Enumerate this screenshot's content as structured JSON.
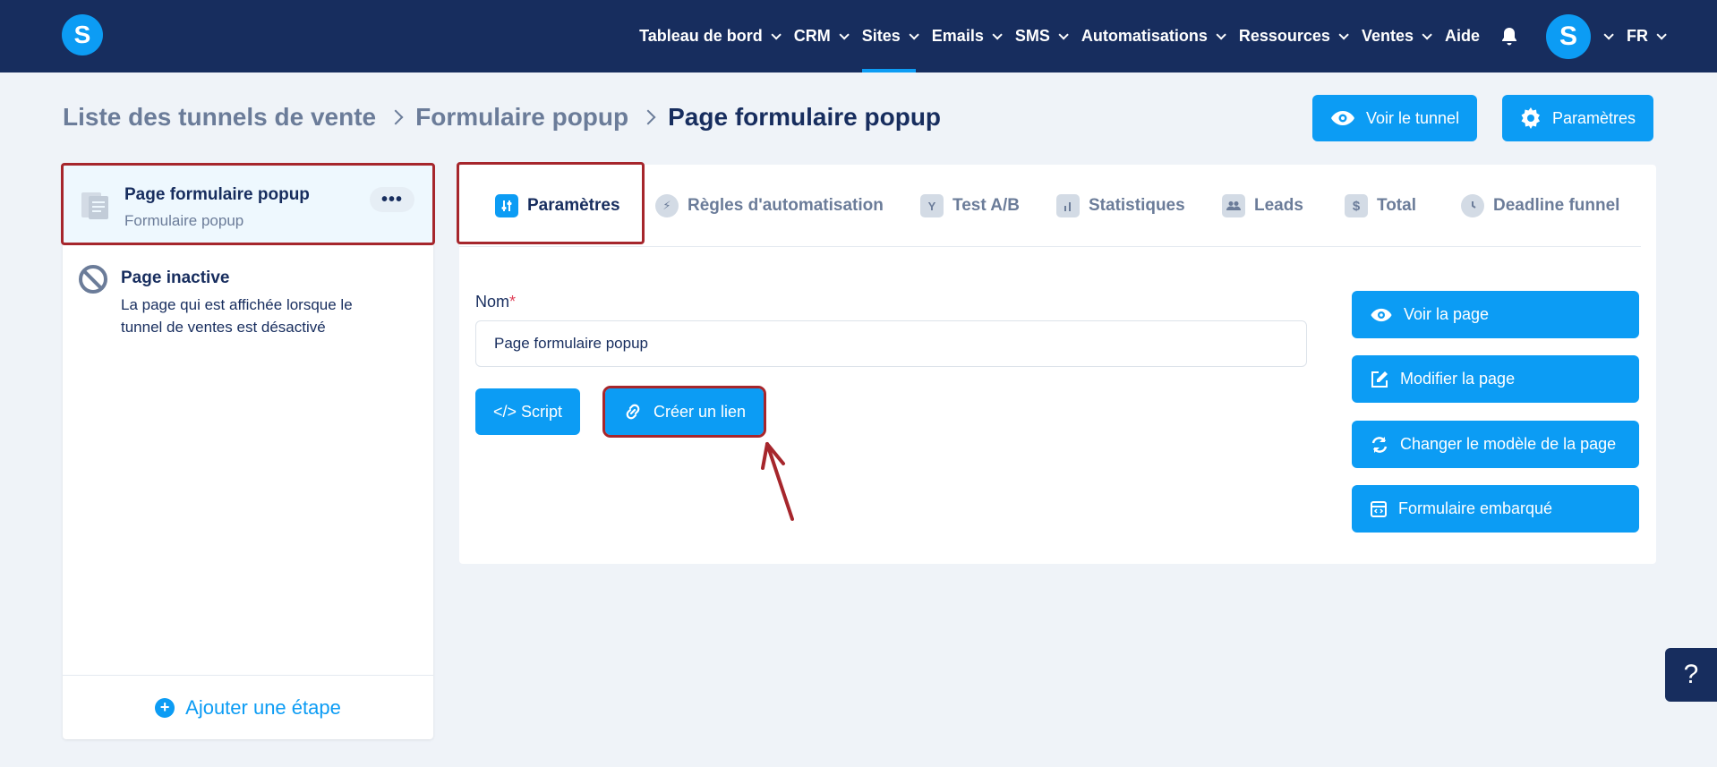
{
  "app": {
    "logo_letter": "S",
    "avatar_letter": "S"
  },
  "nav": {
    "items": [
      {
        "label": "Tableau de bord",
        "has_menu": true
      },
      {
        "label": "CRM",
        "has_menu": true
      },
      {
        "label": "Sites",
        "has_menu": true,
        "active": true
      },
      {
        "label": "Emails",
        "has_menu": true
      },
      {
        "label": "SMS",
        "has_menu": true
      },
      {
        "label": "Automatisations",
        "has_menu": true
      },
      {
        "label": "Ressources",
        "has_menu": true
      },
      {
        "label": "Ventes",
        "has_menu": true
      },
      {
        "label": "Aide",
        "has_menu": false
      }
    ],
    "bell_icon": "bell-icon",
    "language": "FR"
  },
  "breadcrumb": {
    "items": [
      "Liste des tunnels de vente",
      "Formulaire popup"
    ],
    "current": "Page formulaire popup"
  },
  "top_actions": {
    "view_funnel": "Voir le tunnel",
    "settings": "Paramètres"
  },
  "sidebar": {
    "active_step": {
      "title": "Page formulaire popup",
      "subtitle": "Formulaire popup",
      "more": "•••"
    },
    "inactive_step": {
      "title": "Page inactive",
      "description": "La page qui est affichée lorsque le tunnel de ventes est désactivé"
    },
    "add_step": "Ajouter une étape"
  },
  "tabs": [
    {
      "label": "Paramètres",
      "icon": "sliders-icon",
      "active": true
    },
    {
      "label": "Règles d'automatisation",
      "icon": "bolt-icon"
    },
    {
      "label": "Test A/B",
      "icon": "split-icon"
    },
    {
      "label": "Statistiques",
      "icon": "bar-chart-icon"
    },
    {
      "label": "Leads",
      "icon": "users-icon"
    },
    {
      "label": "Total",
      "icon": "dollar-icon"
    },
    {
      "label": "Deadline funnel",
      "icon": "clock-icon"
    }
  ],
  "form": {
    "name_label": "Nom",
    "required_mark": "*",
    "name_value": "Page formulaire popup",
    "script_button": "</> Script",
    "create_link_button": "Créer un lien"
  },
  "side_actions": {
    "view_page": "Voir la page",
    "edit_page": "Modifier la page",
    "change_template": "Changer le modèle de la page",
    "embedded_form": "Formulaire embarqué"
  },
  "help": {
    "label": "?"
  },
  "colors": {
    "navbar": "#172d5e",
    "accent": "#0c9cf4",
    "highlight": "#a6262c",
    "background": "#eff3f8"
  }
}
